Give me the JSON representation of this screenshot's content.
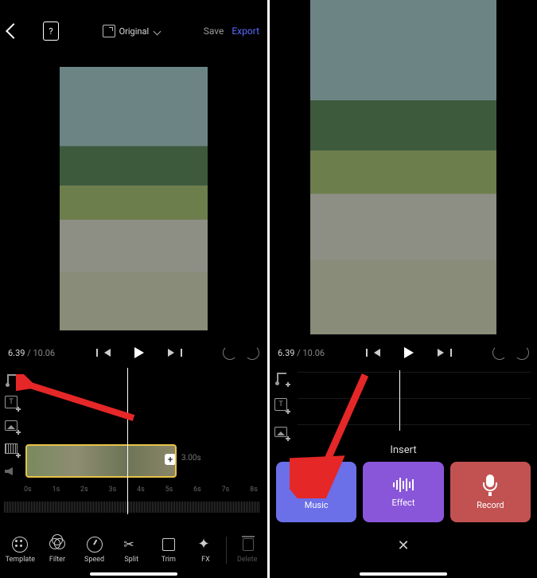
{
  "header": {
    "ratio_label": "Original",
    "save_label": "Save",
    "export_label": "Export"
  },
  "playback": {
    "current_time": "6.39",
    "total_time": "10.06"
  },
  "timeline": {
    "clip_duration": "3.00s",
    "ruler": [
      "0s",
      "1s",
      "2s",
      "3s",
      "4s",
      "5s",
      "6s",
      "7s",
      "8s"
    ]
  },
  "tools": {
    "template": "Template",
    "filter": "Filter",
    "speed": "Speed",
    "split": "Split",
    "trim": "Trim",
    "fx": "FX",
    "delete": "Delete"
  },
  "insert": {
    "title": "Insert",
    "music": "Music",
    "effect": "Effect",
    "record": "Record"
  }
}
